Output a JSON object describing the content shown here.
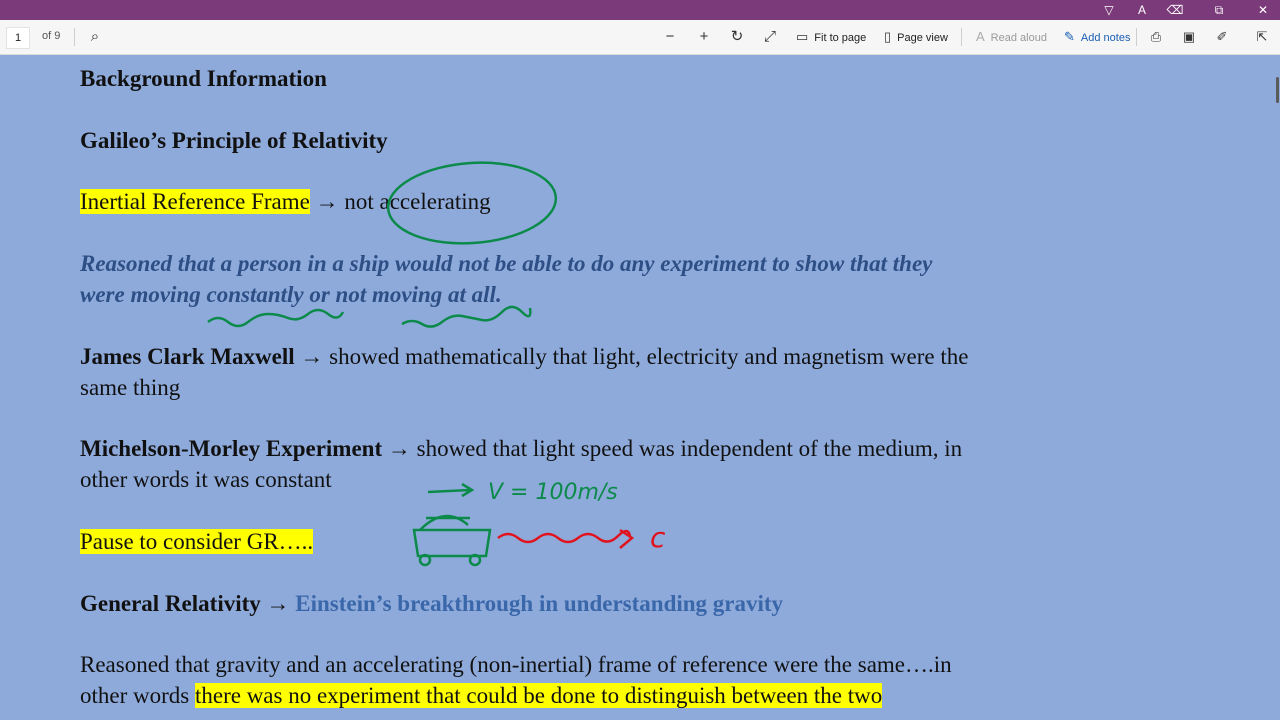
{
  "window": {
    "title_icons": [
      "highlight-icon",
      "translate-icon",
      "eraser-icon",
      "share-icon",
      "close-icon"
    ]
  },
  "toolbar": {
    "page_number": "1",
    "page_total": "of 9",
    "fit_to_page": "Fit to page",
    "page_view": "Page view",
    "read_aloud": "Read aloud",
    "add_notes": "Add notes"
  },
  "document": {
    "heading": "Background Information",
    "subheading": "Galileo’s Principle of Relativity",
    "inertial_term": "Inertial Reference Frame",
    "arrow": "→",
    "inertial_def": "not accelerating",
    "galileo_line1": "Reasoned that a person in a ship would not be able to do any experiment to show that they",
    "galileo_line2": "were moving constantly or not moving at all.",
    "maxwell_name": "James Clark Maxwell",
    "maxwell_line1": "showed mathematically that light, electricity and magnetism were the",
    "maxwell_line2": "same thing",
    "mm_name": "Michelson-Morley Experiment",
    "mm_line1": "showed that light speed was independent of the medium, in",
    "mm_line2": "other words it was constant",
    "pause": "Pause to consider GR…..",
    "gr_name": "General Relativity",
    "gr_desc": "Einstein’s breakthrough in understanding gravity",
    "gr_line1": "Reasoned that gravity and an accelerating (non-inertial) frame of reference were the same….in",
    "gr_line2_plain": "other words",
    "gr_line2_hl": "there was no experiment that could be done to distinguish between the two"
  },
  "annotations": {
    "velocity_note": "V = 100m/s",
    "light_note": "c",
    "colors": {
      "green_ink": "#0c8a4a",
      "red_ink": "#e0141e",
      "highlight": "#ffff00",
      "page_bg": "#8eaadb",
      "titlebar": "#7b3b7a"
    }
  }
}
